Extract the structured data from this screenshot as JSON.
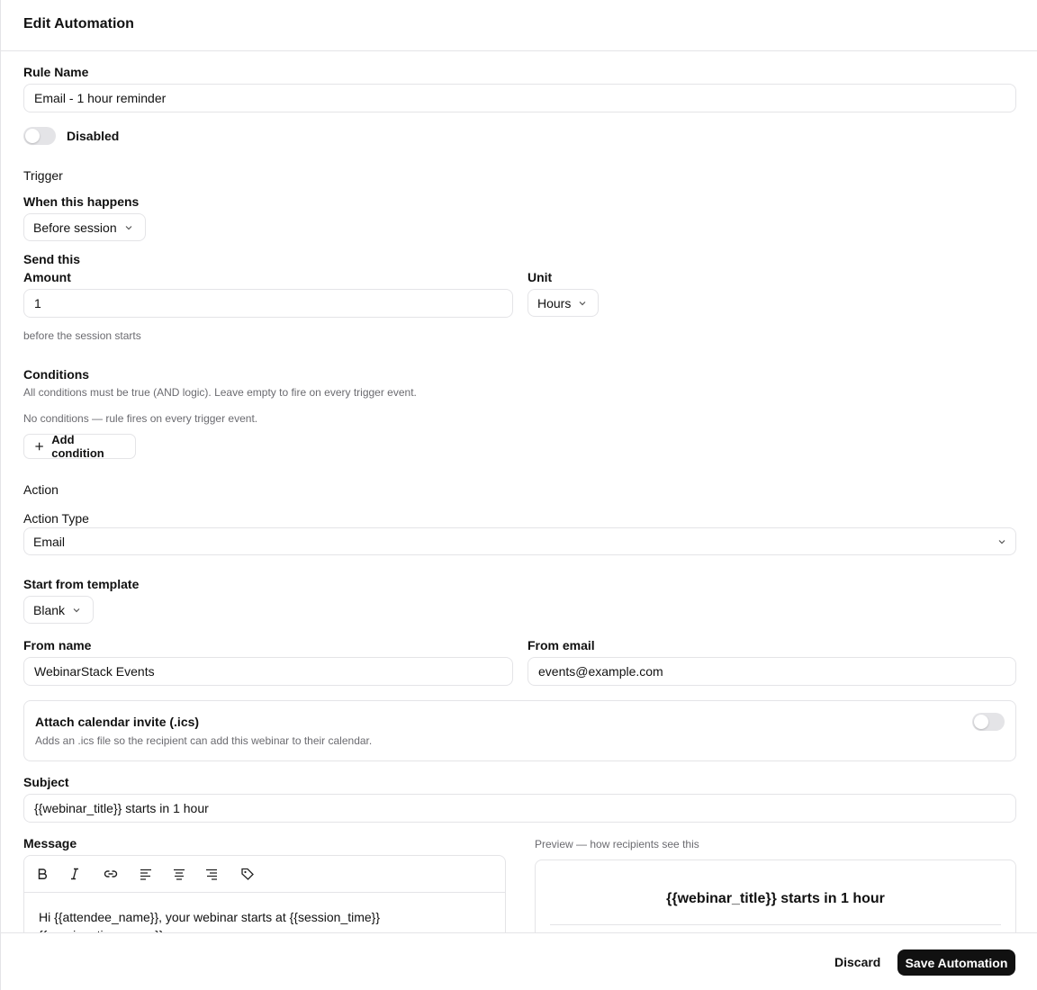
{
  "header": {
    "title": "Edit Automation"
  },
  "rule": {
    "name_label": "Rule Name",
    "name_value": "Email - 1 hour reminder",
    "status_label": "Disabled"
  },
  "trigger": {
    "section": "Trigger",
    "when_label": "When this happens",
    "when_value": "Before session",
    "send_label": "Send this",
    "amount_label": "Amount",
    "amount_value": "1",
    "unit_label": "Unit",
    "unit_value": "Hours",
    "hint": "before the session starts"
  },
  "conditions": {
    "section": "Conditions",
    "description": "All conditions must be true (AND logic). Leave empty to fire on every trigger event.",
    "empty": "No conditions — rule fires on every trigger event.",
    "add_label": "Add condition"
  },
  "action": {
    "section": "Action",
    "type_label": "Action Type",
    "type_value": "Email",
    "template_label": "Start from template",
    "template_value": "Blank",
    "from_name_label": "From name",
    "from_name_value": "WebinarStack Events",
    "from_email_label": "From email",
    "from_email_value": "events@example.com",
    "ics_title": "Attach calendar invite (.ics)",
    "ics_desc": "Adds an .ics file so the recipient can add this webinar to their calendar.",
    "subject_label": "Subject",
    "subject_value": "{{webinar_title}} starts in 1 hour",
    "message_label": "Message",
    "message_line1": "Hi {{attendee_name}}, your webinar starts at {{session_time}}",
    "message_line2": "{{session_time_zone}}",
    "preview_label": "Preview — how recipients see this",
    "preview_heading": "{{webinar_title}} starts in 1 hour"
  },
  "footer": {
    "discard_label": "Discard",
    "save_label": "Save Automation"
  },
  "icons": [
    "bold-icon",
    "italic-icon",
    "link-icon",
    "align-left-icon",
    "align-center-icon",
    "align-right-icon",
    "tag-icon",
    "chevron-down-icon",
    "plus-icon"
  ]
}
